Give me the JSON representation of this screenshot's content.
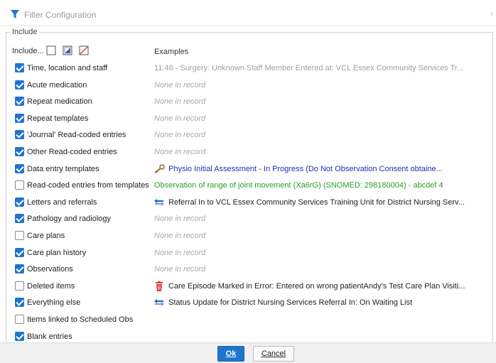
{
  "window": {
    "title": "Filter Configuration",
    "icon": "funnel-icon"
  },
  "group": {
    "label": "Include"
  },
  "header": {
    "include_label": "Include...",
    "examples_label": "Examples"
  },
  "rows": [
    {
      "label": "Time, location and staff",
      "checked": true,
      "example": "11:46 - Surgery: Unknown Staff Member  Entered at: VCL Essex Community Services Tr...",
      "style": "gray",
      "icon": ""
    },
    {
      "label": "Acute medication",
      "checked": true,
      "example": "None in record",
      "style": "none",
      "icon": ""
    },
    {
      "label": "Repeat medication",
      "checked": true,
      "example": "None in record",
      "style": "none",
      "icon": ""
    },
    {
      "label": "Repeat templates",
      "checked": true,
      "example": "None in record",
      "style": "none",
      "icon": ""
    },
    {
      "label": "'Journal' Read-coded entries",
      "checked": true,
      "example": "None in record",
      "style": "none",
      "icon": ""
    },
    {
      "label": "Other Read-coded entries",
      "checked": true,
      "example": "None in record",
      "style": "none",
      "icon": ""
    },
    {
      "label": "Data entry templates",
      "checked": true,
      "example": "Physio Initial Assessment  - In Progress (Do Not   Observation       Consent obtaine...",
      "style": "blue",
      "icon": "key-icon"
    },
    {
      "label": "Read-coded entries from templates",
      "checked": false,
      "example": "Observation of range of joint movement (Xa6rG) (SNOMED: 298180004) - abcdef 4",
      "style": "green",
      "icon": ""
    },
    {
      "label": "Letters and referrals",
      "checked": true,
      "example": "Referral In to VCL Essex Community Services Training Unit for District Nursing Serv...",
      "style": "black",
      "icon": "arrows-icon"
    },
    {
      "label": "Pathology and radiology",
      "checked": true,
      "example": "None in record",
      "style": "none",
      "icon": ""
    },
    {
      "label": "Care plans",
      "checked": false,
      "example": "None in record",
      "style": "none",
      "icon": ""
    },
    {
      "label": "Care plan history",
      "checked": true,
      "example": "None in record",
      "style": "none",
      "icon": ""
    },
    {
      "label": "Observations",
      "checked": true,
      "example": "None in record",
      "style": "none",
      "icon": ""
    },
    {
      "label": "Deleted items",
      "checked": false,
      "example": "Care Episode Marked in Error: Entered on wrong patientAndy's Test Care Plan Visiti...",
      "style": "black",
      "icon": "trash-icon"
    },
    {
      "label": "Everything else",
      "checked": true,
      "example": "Status Update for District Nursing Services Referral In: On Waiting List",
      "style": "black",
      "icon": "arrows-icon"
    },
    {
      "label": "Items linked to Scheduled Obs",
      "checked": false,
      "example": "",
      "style": "none",
      "icon": ""
    },
    {
      "label": "Blank entries",
      "checked": true,
      "example": "",
      "style": "none",
      "icon": ""
    }
  ],
  "buttons": {
    "ok": "Ok",
    "cancel": "Cancel"
  },
  "colors": {
    "accent": "#1f75cc",
    "green": "#2e9a2e",
    "blue": "#2a2ab8",
    "trash": "#e03c3c"
  }
}
